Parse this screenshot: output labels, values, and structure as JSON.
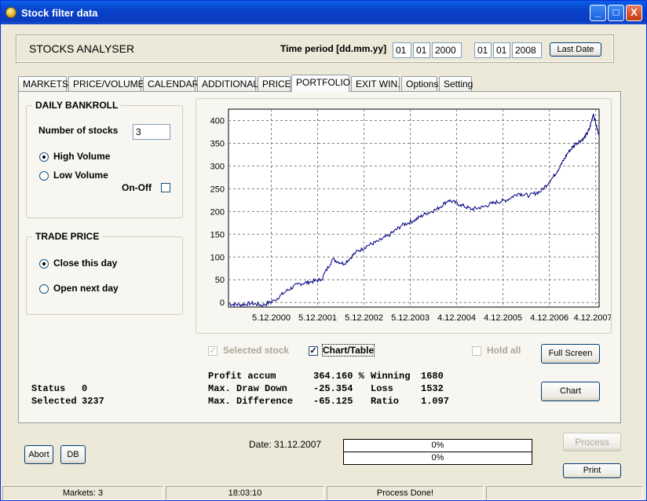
{
  "window": {
    "title": "Stock filter data",
    "min_glyph": "_",
    "max_glyph": "□",
    "close_glyph": "X"
  },
  "header": {
    "app_name": "STOCKS ANALYSER",
    "time_period_label": "Time period [dd.mm.yy]",
    "start": {
      "dd": "01",
      "mm": "01",
      "yy": "2000"
    },
    "end": {
      "dd": "01",
      "mm": "01",
      "yy": "2008"
    },
    "last_date_button": "Last Date"
  },
  "tabs": [
    "MARKETS",
    "PRICE/VOLUME",
    "CALENDAR",
    "ADDITIONAL",
    "PRICE",
    "PORTFOLIO",
    "EXIT WIN.",
    "Options",
    "Setting"
  ],
  "active_tab": "PORTFOLIO",
  "daily_bankroll": {
    "title": "DAILY BANKROLL",
    "number_of_stocks_label": "Number of stocks",
    "number_of_stocks": "3",
    "high_volume_label": "High Volume",
    "low_volume_label": "Low Volume",
    "on_off_label": "On-Off",
    "selected_volume": "high"
  },
  "trade_price": {
    "title": "TRADE PRICE",
    "close_label": "Close this day",
    "open_label": "Open next day",
    "selected": "close"
  },
  "options_row": {
    "selected_stock_label": "Selected stock",
    "chart_table_label": "Chart/Table",
    "hold_all_label": "Hold all",
    "full_screen_button": "Full Screen",
    "chart_button": "Chart"
  },
  "stats": {
    "profit_accum_label": "Profit accum",
    "profit_accum": "364.160 %",
    "max_draw_down_label": "Max. Draw Down",
    "max_draw_down": "-25.354",
    "max_difference_label": "Max. Difference",
    "max_difference": "-65.125",
    "winning_label": "Winning",
    "winning": "1680",
    "loss_label": "Loss",
    "loss": "1532",
    "ratio_label": "Ratio",
    "ratio": "1.097"
  },
  "status_info": {
    "status_label": "Status",
    "status": "0",
    "selected_label": "Selected",
    "selected": "3237"
  },
  "bottom": {
    "abort_button": "Abort",
    "db_button": "DB",
    "date_text": "Date: 31.12.2007",
    "progress1": "0%",
    "progress2": "0%",
    "process_button": "Process",
    "print_button": "Print"
  },
  "statusbar": {
    "markets": "Markets: 3",
    "time": "18:03:10",
    "message": "Process Done!"
  },
  "colors": {
    "line": "#000080",
    "grid": "#808080",
    "plot_bg": "#ffffff",
    "titlebar": "#0a47d0"
  },
  "chart_data": {
    "type": "line",
    "title": "",
    "xlabel": "",
    "ylabel": "",
    "x_ticks": [
      "5.12.2000",
      "5.12.2001",
      "5.12.2002",
      "5.12.2003",
      "4.12.2004",
      "4.12.2005",
      "4.12.2006",
      "4.12.2007"
    ],
    "y_ticks": [
      0,
      50,
      100,
      150,
      200,
      250,
      300,
      350,
      400
    ],
    "ylim": [
      -10,
      425
    ],
    "xlim": [
      "2000-01-03",
      "2007-12-31"
    ],
    "grid": true,
    "series": [
      {
        "x": [
          "2000-01-03",
          "2000-04-01",
          "2000-07-01",
          "2000-10-01",
          "2001-01-01",
          "2001-04-01",
          "2001-07-01",
          "2001-10-01",
          "2002-01-01",
          "2002-04-01",
          "2002-07-01",
          "2002-10-01",
          "2003-01-01",
          "2003-04-01",
          "2003-07-01",
          "2003-10-01",
          "2004-01-01",
          "2004-04-01",
          "2004-07-01",
          "2004-10-01",
          "2005-01-01",
          "2005-04-01",
          "2005-07-01",
          "2005-10-01",
          "2006-01-01",
          "2006-04-01",
          "2006-07-01",
          "2006-10-01",
          "2007-01-01",
          "2007-03-01",
          "2007-05-01",
          "2007-07-01",
          "2007-09-01",
          "2007-10-15",
          "2007-11-15",
          "2007-12-31"
        ],
        "values": [
          -3,
          -5,
          -2,
          -6,
          5,
          25,
          40,
          45,
          50,
          95,
          85,
          110,
          125,
          135,
          150,
          170,
          180,
          195,
          205,
          225,
          215,
          205,
          210,
          220,
          225,
          240,
          235,
          245,
          275,
          300,
          330,
          350,
          360,
          380,
          415,
          365
        ]
      }
    ]
  }
}
